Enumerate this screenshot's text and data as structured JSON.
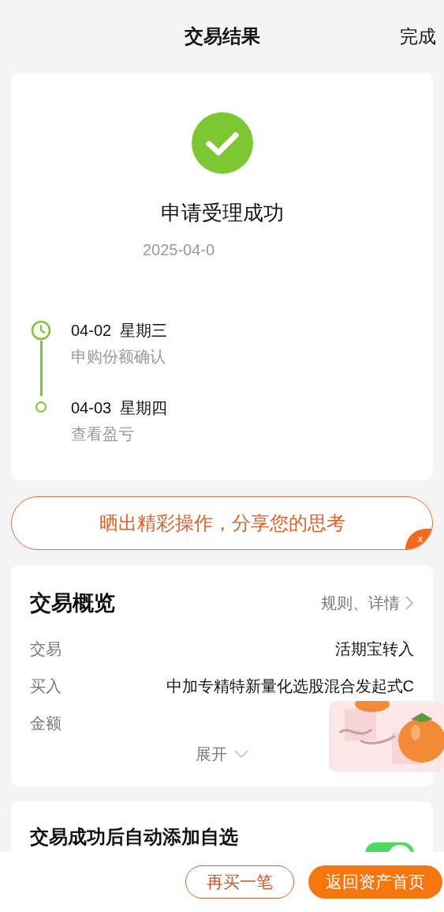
{
  "header": {
    "title": "交易结果",
    "done": "完成"
  },
  "result": {
    "title": "申请受理成功",
    "time": "2025-04-0"
  },
  "timeline": [
    {
      "date": "04-02  星期三",
      "note": "申购份额确认",
      "kind": "clock"
    },
    {
      "date": "04-03  星期四",
      "note": "查看盈亏",
      "kind": "dot"
    }
  ],
  "share_banner": {
    "text": "晒出精彩操作，分享您的思考",
    "close": "x"
  },
  "overview": {
    "title": "交易概览",
    "link": "规则、详情",
    "rows": [
      {
        "label": "交易",
        "value": "活期宝转入"
      },
      {
        "label": "买入",
        "value": "中加专精特新量化选股混合发起式C"
      },
      {
        "label": "金额"
      }
    ],
    "expand": "展开"
  },
  "auto_add": {
    "label": "交易成功后自动添加自选",
    "on": true
  },
  "buttons": [
    {
      "label": "再买一笔",
      "kind": "outline"
    },
    {
      "label": "返回资产首页",
      "kind": "primary"
    }
  ]
}
